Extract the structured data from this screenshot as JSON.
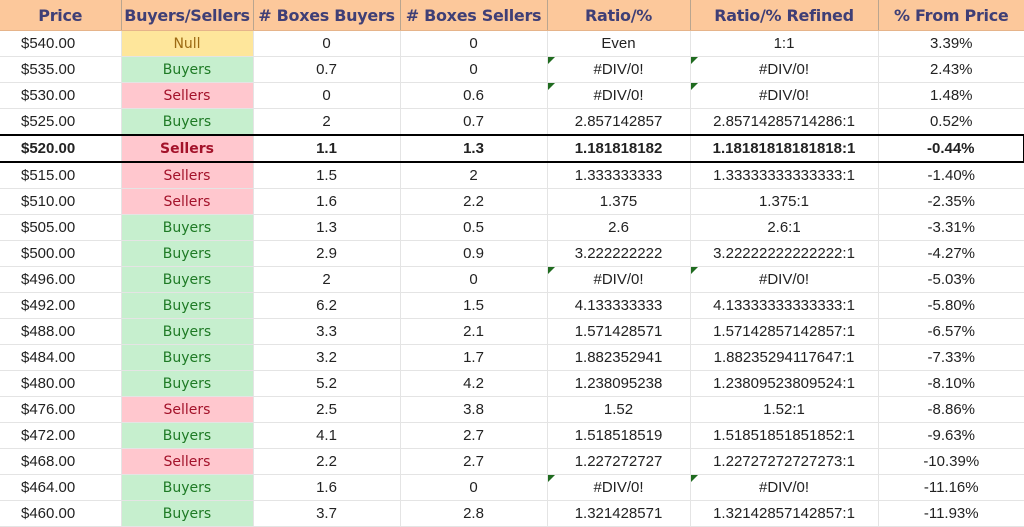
{
  "columns": [
    "Price",
    "Buyers/Sellers",
    "# Boxes Buyers",
    "# Boxes Sellers",
    "Ratio/%",
    "Ratio/% Refined",
    "% From Price"
  ],
  "colors": {
    "header_bg": "#fcc89b",
    "header_text": "#3f3f76",
    "buyers_bg": "#c6efce",
    "buyers_text": "#1e7a25",
    "sellers_bg": "#ffc7ce",
    "sellers_text": "#a3122a",
    "null_bg": "#fee69b",
    "null_text": "#9c6a13",
    "error_flag": "#1f6b1f"
  },
  "highlighted_row_price": "$520.00",
  "rows": [
    {
      "price": "$540.00",
      "side": "Null",
      "buyers": "0",
      "sellers": "0",
      "ratio": "Even",
      "refined": "1:1",
      "from_price": "3.39%",
      "error": false
    },
    {
      "price": "$535.00",
      "side": "Buyers",
      "buyers": "0.7",
      "sellers": "0",
      "ratio": "#DIV/0!",
      "refined": "#DIV/0!",
      "from_price": "2.43%",
      "error": true
    },
    {
      "price": "$530.00",
      "side": "Sellers",
      "buyers": "0",
      "sellers": "0.6",
      "ratio": "#DIV/0!",
      "refined": "#DIV/0!",
      "from_price": "1.48%",
      "error": true
    },
    {
      "price": "$525.00",
      "side": "Buyers",
      "buyers": "2",
      "sellers": "0.7",
      "ratio": "2.857142857",
      "refined": "2.85714285714286:1",
      "from_price": "0.52%",
      "error": false
    },
    {
      "price": "$520.00",
      "side": "Sellers",
      "buyers": "1.1",
      "sellers": "1.3",
      "ratio": "1.181818182",
      "refined": "1.18181818181818:1",
      "from_price": "-0.44%",
      "error": false,
      "highlight": true
    },
    {
      "price": "$515.00",
      "side": "Sellers",
      "buyers": "1.5",
      "sellers": "2",
      "ratio": "1.333333333",
      "refined": "1.33333333333333:1",
      "from_price": "-1.40%",
      "error": false
    },
    {
      "price": "$510.00",
      "side": "Sellers",
      "buyers": "1.6",
      "sellers": "2.2",
      "ratio": "1.375",
      "refined": "1.375:1",
      "from_price": "-2.35%",
      "error": false
    },
    {
      "price": "$505.00",
      "side": "Buyers",
      "buyers": "1.3",
      "sellers": "0.5",
      "ratio": "2.6",
      "refined": "2.6:1",
      "from_price": "-3.31%",
      "error": false
    },
    {
      "price": "$500.00",
      "side": "Buyers",
      "buyers": "2.9",
      "sellers": "0.9",
      "ratio": "3.222222222",
      "refined": "3.22222222222222:1",
      "from_price": "-4.27%",
      "error": false
    },
    {
      "price": "$496.00",
      "side": "Buyers",
      "buyers": "2",
      "sellers": "0",
      "ratio": "#DIV/0!",
      "refined": "#DIV/0!",
      "from_price": "-5.03%",
      "error": true
    },
    {
      "price": "$492.00",
      "side": "Buyers",
      "buyers": "6.2",
      "sellers": "1.5",
      "ratio": "4.133333333",
      "refined": "4.13333333333333:1",
      "from_price": "-5.80%",
      "error": false
    },
    {
      "price": "$488.00",
      "side": "Buyers",
      "buyers": "3.3",
      "sellers": "2.1",
      "ratio": "1.571428571",
      "refined": "1.57142857142857:1",
      "from_price": "-6.57%",
      "error": false
    },
    {
      "price": "$484.00",
      "side": "Buyers",
      "buyers": "3.2",
      "sellers": "1.7",
      "ratio": "1.882352941",
      "refined": "1.88235294117647:1",
      "from_price": "-7.33%",
      "error": false
    },
    {
      "price": "$480.00",
      "side": "Buyers",
      "buyers": "5.2",
      "sellers": "4.2",
      "ratio": "1.238095238",
      "refined": "1.23809523809524:1",
      "from_price": "-8.10%",
      "error": false
    },
    {
      "price": "$476.00",
      "side": "Sellers",
      "buyers": "2.5",
      "sellers": "3.8",
      "ratio": "1.52",
      "refined": "1.52:1",
      "from_price": "-8.86%",
      "error": false
    },
    {
      "price": "$472.00",
      "side": "Buyers",
      "buyers": "4.1",
      "sellers": "2.7",
      "ratio": "1.518518519",
      "refined": "1.51851851851852:1",
      "from_price": "-9.63%",
      "error": false
    },
    {
      "price": "$468.00",
      "side": "Sellers",
      "buyers": "2.2",
      "sellers": "2.7",
      "ratio": "1.227272727",
      "refined": "1.22727272727273:1",
      "from_price": "-10.39%",
      "error": false
    },
    {
      "price": "$464.00",
      "side": "Buyers",
      "buyers": "1.6",
      "sellers": "0",
      "ratio": "#DIV/0!",
      "refined": "#DIV/0!",
      "from_price": "-11.16%",
      "error": true
    },
    {
      "price": "$460.00",
      "side": "Buyers",
      "buyers": "3.7",
      "sellers": "2.8",
      "ratio": "1.321428571",
      "refined": "1.32142857142857:1",
      "from_price": "-11.93%",
      "error": false
    }
  ]
}
